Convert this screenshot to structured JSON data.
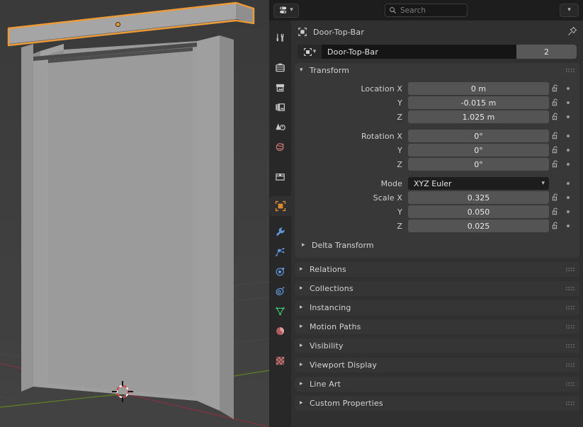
{
  "viewport": {
    "name": "3d-viewport",
    "object_label": "Door-Top-Bar",
    "selection_color": "#ED9B38",
    "background_color": "#3E3E3E",
    "mesh_color": "#9C9C9C",
    "axis_x_color": "#6B3038",
    "axis_y_color": "#5A7A28"
  },
  "header": {
    "editor_type_icon": "properties-editor-icon",
    "editor_dropdown_icon": "chevron-down-icon",
    "search": {
      "placeholder": "Search",
      "value": "",
      "icon": "search-icon"
    },
    "options_icon": "chevron-down-icon"
  },
  "tabs": [
    {
      "id": "tool",
      "label": "Tool",
      "icon": "tool-icon",
      "active": false,
      "color": "#c8c8c8"
    },
    {
      "id": "render",
      "label": "Render",
      "icon": "camera-back-icon",
      "active": false,
      "color": "#c8c8c8"
    },
    {
      "id": "output",
      "label": "Output",
      "icon": "printer-icon",
      "active": false,
      "color": "#c8c8c8"
    },
    {
      "id": "view-layer",
      "label": "View Layer",
      "icon": "images-icon",
      "active": false,
      "color": "#c8c8c8"
    },
    {
      "id": "scene",
      "label": "Scene",
      "icon": "scene-cone-icon",
      "active": false,
      "color": "#c8c8c8"
    },
    {
      "id": "world",
      "label": "World",
      "icon": "world-globe-icon",
      "active": false,
      "color": "#b56b6b"
    },
    {
      "id": "collection",
      "label": "Collection",
      "icon": "collection-box-icon",
      "active": false,
      "color": "#c8c8c8"
    },
    {
      "id": "object",
      "label": "Object",
      "icon": "object-square-icon",
      "active": true,
      "color": "#e08a30"
    },
    {
      "id": "modifiers",
      "label": "Modifiers",
      "icon": "wrench-icon",
      "active": false,
      "color": "#5f97d8"
    },
    {
      "id": "particles",
      "label": "Particles",
      "icon": "particles-icon",
      "active": false,
      "color": "#5f97d8"
    },
    {
      "id": "physics",
      "label": "Physics",
      "icon": "physics-orbit-icon",
      "active": false,
      "color": "#5f97d8"
    },
    {
      "id": "constraints",
      "label": "Object Constraints",
      "icon": "constraint-icon",
      "active": false,
      "color": "#5f97d8"
    },
    {
      "id": "data",
      "label": "Object Data",
      "icon": "mesh-data-icon",
      "active": false,
      "color": "#3fbf6f"
    },
    {
      "id": "material",
      "label": "Material",
      "icon": "material-sphere-icon",
      "active": false,
      "color": "#b05a5a"
    },
    {
      "id": "texture",
      "label": "Texture",
      "icon": "texture-checker-icon",
      "active": false,
      "color": "#c07878"
    }
  ],
  "breadcrumb": {
    "icon": "object-square-icon",
    "label": "Door-Top-Bar",
    "pin_icon": "pin-icon"
  },
  "name_row": {
    "id_icon": "object-square-icon",
    "dropdown_icon": "chevron-down-icon",
    "value": "Door-Top-Bar",
    "users_count": "2"
  },
  "transform_panel": {
    "title": "Transform",
    "expanded": true,
    "rows": [
      {
        "label": "Location X",
        "value": "0 m",
        "lock": true,
        "deco": true
      },
      {
        "label": "Y",
        "value": "-0.015 m",
        "lock": true,
        "deco": true
      },
      {
        "label": "Z",
        "value": "1.025 m",
        "lock": true,
        "deco": true
      },
      {
        "label": "Rotation X",
        "value": "0°",
        "lock": true,
        "deco": true,
        "group_start": true
      },
      {
        "label": "Y",
        "value": "0°",
        "lock": true,
        "deco": true
      },
      {
        "label": "Z",
        "value": "0°",
        "lock": true,
        "deco": true
      }
    ],
    "mode": {
      "label": "Mode",
      "value": "XYZ Euler",
      "deco": true
    },
    "scale_rows": [
      {
        "label": "Scale X",
        "value": "0.325",
        "lock": true,
        "deco": true
      },
      {
        "label": "Y",
        "value": "0.050",
        "lock": true,
        "deco": true
      },
      {
        "label": "Z",
        "value": "0.025",
        "lock": true,
        "deco": true
      }
    ],
    "delta_transform": {
      "label": "Delta Transform",
      "expanded": false
    }
  },
  "panels": [
    {
      "id": "relations",
      "title": "Relations",
      "expanded": false
    },
    {
      "id": "collections",
      "title": "Collections",
      "expanded": false
    },
    {
      "id": "instancing",
      "title": "Instancing",
      "expanded": false
    },
    {
      "id": "motion-paths",
      "title": "Motion Paths",
      "expanded": false
    },
    {
      "id": "visibility",
      "title": "Visibility",
      "expanded": false
    },
    {
      "id": "viewport-display",
      "title": "Viewport Display",
      "expanded": false
    },
    {
      "id": "line-art",
      "title": "Line Art",
      "expanded": false
    },
    {
      "id": "custom-properties",
      "title": "Custom Properties",
      "expanded": false
    }
  ]
}
